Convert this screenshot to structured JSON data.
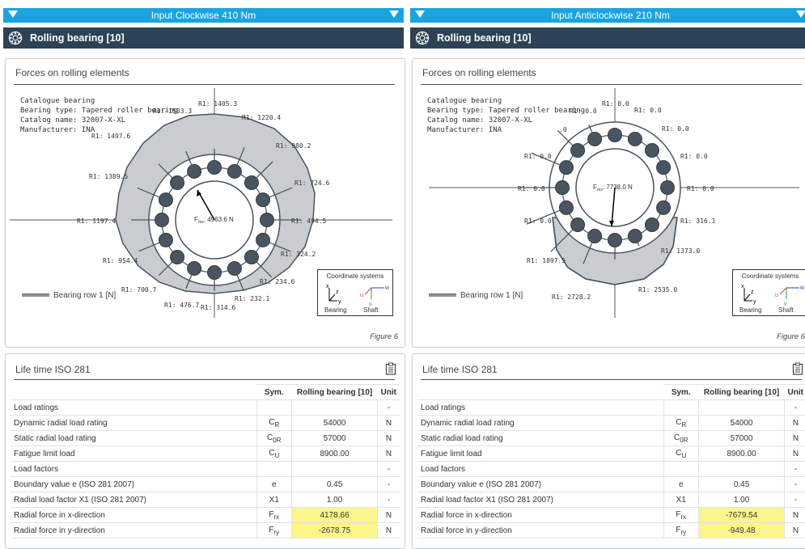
{
  "panels": [
    {
      "header": "Input Clockwise 410 Nm",
      "section_title": "Rolling bearing [10]",
      "forces_title": "Forces on rolling elements",
      "info": [
        "Catalogue bearing",
        "Bearing type: Tapered roller bearing",
        "Catalog name: 32007-X-XL",
        "Manufacturer: INA"
      ],
      "fres": "4963.6 N",
      "legend": "Bearing row 1 [N]",
      "figure": "Figure 6",
      "force_labels": [
        "R1: 1405.3",
        "R1: 1503.3",
        "R1: 1220.4",
        "R1: 1497.6",
        "R1: 980.2",
        "R1: 1389.5",
        "R1: 724.6",
        "R1: 1197.4",
        "R1: 494.5",
        "R1: 954.4",
        "R1: 324.2",
        "R1: 700.7",
        "R1: 234.6",
        "R1: 476.7",
        "R1: 314.6",
        "R1: 232.1"
      ],
      "life_title": "Life time ISO 281",
      "table": {
        "headers": [
          "",
          "Sym.",
          "Rolling bearing [10]",
          "Unit"
        ],
        "rows": [
          {
            "param": "Load ratings",
            "sym": "",
            "val": "",
            "unit": "-"
          },
          {
            "param": "Dynamic radial load rating",
            "sym": "C_R",
            "val": "54000",
            "unit": "N"
          },
          {
            "param": "Static radial load rating",
            "sym": "C_0R",
            "val": "57000",
            "unit": "N"
          },
          {
            "param": "Fatigue limit load",
            "sym": "C_U",
            "val": "8900.00",
            "unit": "N"
          },
          {
            "param": "Load factors",
            "sym": "",
            "val": "",
            "unit": "-"
          },
          {
            "param": "Boundary value e (ISO 281 2007)",
            "sym": "e",
            "val": "0.45",
            "unit": "-"
          },
          {
            "param": "Radial load factor X1 (ISO 281 2007)",
            "sym": "X1",
            "val": "1.00",
            "unit": "-"
          },
          {
            "param": "Radial force in x-direction",
            "sym": "F_rx",
            "val": "4178.66",
            "unit": "N"
          },
          {
            "param": "Radial force in y-direction",
            "sym": "F_ry",
            "val": "-2678.75",
            "unit": "N"
          }
        ]
      }
    },
    {
      "header": "Input Anticlockwise 210 Nm",
      "section_title": "Rolling bearing [10]",
      "forces_title": "Forces on rolling elements",
      "info": [
        "Catalogue bearing",
        "Bearing type: Tapered roller bearing",
        "Catalog name: 32007-X-XL",
        "Manufacturer: INA"
      ],
      "fres": "7738.0 N",
      "legend": "Bearing row 1 [N]",
      "figure": "Figure 6",
      "force_labels": [
        "R1: 0.0",
        "R1: 0.0",
        "R1: 0.0",
        ".0",
        "R1: 0.0",
        "R1: 0.0",
        "R1: 0.0",
        "R1: 0.0",
        "R1: 0.0",
        "R1: 0.0",
        "R1: 316.1",
        "R1: 1373.0",
        "R1: 1897.5",
        "R1: 2535.0",
        "R1: 2728.2"
      ],
      "life_title": "Life time ISO 281",
      "table": {
        "headers": [
          "",
          "Sym.",
          "Rolling bearing [10]",
          "Unit"
        ],
        "rows": [
          {
            "param": "Load ratings",
            "sym": "",
            "val": "",
            "unit": "-"
          },
          {
            "param": "Dynamic radial load rating",
            "sym": "C_R",
            "val": "54000",
            "unit": "N"
          },
          {
            "param": "Static radial load rating",
            "sym": "C_0R",
            "val": "57000",
            "unit": "N"
          },
          {
            "param": "Fatigue limit load",
            "sym": "C_U",
            "val": "8900.00",
            "unit": "N"
          },
          {
            "param": "Load factors",
            "sym": "",
            "val": "",
            "unit": "-"
          },
          {
            "param": "Boundary value e (ISO 281 2007)",
            "sym": "e",
            "val": "0.45",
            "unit": "-"
          },
          {
            "param": "Radial load factor X1 (ISO 281 2007)",
            "sym": "X1",
            "val": "1.00",
            "unit": "-"
          },
          {
            "param": "Radial force in x-direction",
            "sym": "F_rx",
            "val": "-7679.54",
            "unit": "N"
          },
          {
            "param": "Radial force in y-direction",
            "sym": "F_ry",
            "val": "-949.48",
            "unit": "N"
          }
        ]
      }
    }
  ],
  "coord_box": {
    "title": "Coordinate systems",
    "left_label": "Bearing",
    "right_label": "Shaft"
  },
  "colors": {
    "header_blue": "#1aa3df",
    "dark_bar": "#2d4254",
    "highlight": "#fbf58c",
    "ring_fill": "#c9cdd1",
    "roller": "#4a5561"
  },
  "icons": {
    "bearing": "bearing-icon",
    "collapse": "triangle-down-icon",
    "clipboard": "clipboard-icon"
  }
}
